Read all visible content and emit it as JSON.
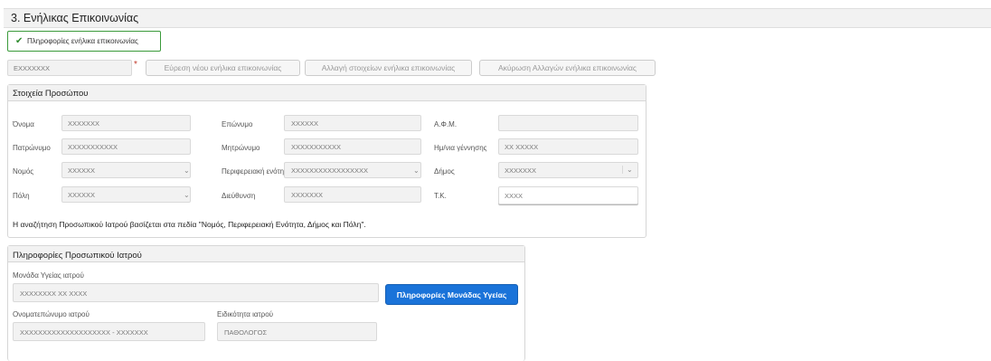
{
  "section": {
    "title": "3. Ενήλικας Επικοινωνίας"
  },
  "info": {
    "label": "Πληροφορίες ενήλικα επικοινωνίας"
  },
  "search": {
    "value": "ΕΧΧΧΧΧΧΧ",
    "required_mark": "*"
  },
  "buttons": {
    "find_new": "Εύρεση νέου ενήλικα επικοινωνίας",
    "change": "Αλλαγή στοιχείων ενήλικα επικοινωνίας",
    "cancel": "Ακύρωση Αλλαγών ενήλικα επικοινωνίας",
    "health_unit_info": "Πληροφορίες Μονάδας Υγείας"
  },
  "person": {
    "title": "Στοιχεία Προσώπου",
    "first_name": {
      "label": "Όνομα",
      "value": "ΧΧΧΧΧΧΧ"
    },
    "last_name": {
      "label": "Επώνυμο",
      "value": "ΧΧΧΧΧΧ"
    },
    "afm": {
      "label": "Α.Φ.Μ.",
      "value": ""
    },
    "father_name": {
      "label": "Πατρώνυμο",
      "value": "ΧΧΧΧΧΧΧΧΧΧΧ"
    },
    "mother_name": {
      "label": "Μητρώνυμο",
      "value": "ΧΧΧΧΧΧΧΧΧΧΧ"
    },
    "birth_date": {
      "label": "Ημ/νια γέννησης",
      "value": "ΧΧ ΧΧΧΧΧ"
    },
    "prefecture": {
      "label": "Νομός",
      "value": "ΧΧΧΧΧΧ"
    },
    "region": {
      "label": "Περιφερειακή ενότητα",
      "value": "ΧΧΧΧΧΧΧΧΧΧΧΧΧΧΧΧΧ"
    },
    "municipality": {
      "label": "Δήμος",
      "value": "ΧΧΧΧΧΧΧ"
    },
    "city": {
      "label": "Πόλη",
      "value": "ΧΧΧΧΧΧ"
    },
    "address": {
      "label": "Διεύθυνση",
      "value": "ΧΧΧΧΧΧΧ"
    },
    "postal_code": {
      "label": "Τ.Κ.",
      "value": "ΧΧΧΧ"
    },
    "note": "Η αναζήτηση Προσωπικού Ιατρού βασίζεται στα πεδία \"Νομός, Περιφερειακή Ενότητα, Δήμος και Πόλη\"."
  },
  "doctor": {
    "title": "Πληροφορίες Προσωπικού Ιατρού",
    "unit": {
      "label": "Μονάδα Υγείας ιατρού",
      "value": "ΧΧΧΧΧΧΧΧ ΧΧ ΧΧΧΧ"
    },
    "name": {
      "label": "Ονοματεπώνυμο ιατρού",
      "value": "ΧΧΧΧΧΧΧΧΧΧΧΧΧΧΧΧΧΧΧΧ - ΧΧΧΧΧΧΧ"
    },
    "specialty": {
      "label": "Ειδικότητα ιατρού",
      "value": "ΠΑΘΟΛΟΓΟΣ"
    }
  },
  "colors": {
    "accent_blue": "#1a73d9",
    "success_green": "#3a9a3a",
    "required_red": "#c0392b"
  },
  "icons": {
    "check": "check-icon",
    "dropdown": "chevron-down-icon"
  }
}
